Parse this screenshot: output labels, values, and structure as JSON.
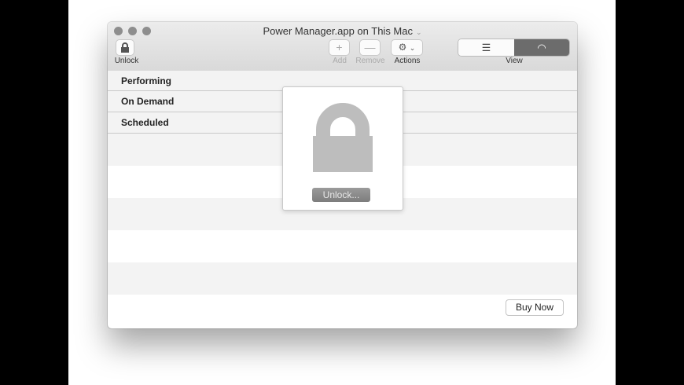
{
  "window": {
    "title": "Power Manager.app on This Mac"
  },
  "toolbar": {
    "unlock_label": "Unlock",
    "add_label": "Add",
    "remove_label": "Remove",
    "actions_label": "Actions",
    "view_label": "View",
    "add_icon": "+",
    "remove_icon": "—",
    "list_icon": "☰",
    "gauge_icon": "◠"
  },
  "list": {
    "rows": [
      {
        "label": "Performing"
      },
      {
        "label": "On Demand"
      },
      {
        "label": "Scheduled"
      }
    ]
  },
  "lock_panel": {
    "button_label": "Unlock..."
  },
  "footer": {
    "buy_label": "Buy Now"
  }
}
